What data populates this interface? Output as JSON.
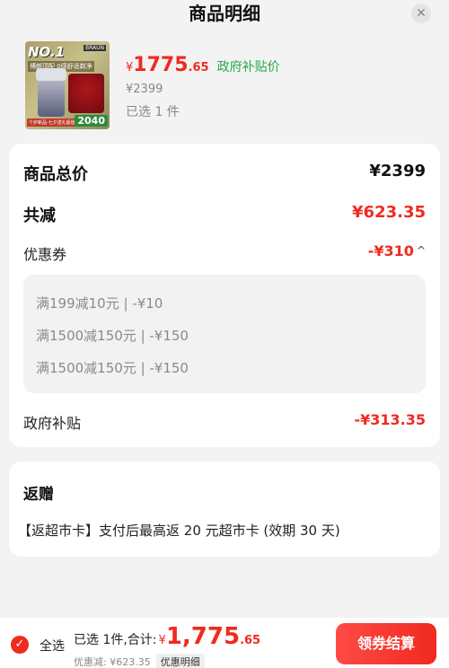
{
  "header": {
    "title": "商品明细",
    "close_icon": "close-icon"
  },
  "product": {
    "image_text": {
      "no1": "NO.1",
      "brand": "BRAUN",
      "slogan": "博朗顶配 0感舒适剃净",
      "badge_top": "个护新品·七夕送礼超值",
      "badge": "2040"
    },
    "price_symbol": "¥",
    "price_int": "1775",
    "price_dec": ".65",
    "price_tag": "政府补贴价",
    "original_price": "¥2399",
    "selected_count": "已选 1 件"
  },
  "summary": {
    "total_label": "商品总价",
    "total_value": "¥2399",
    "reduce_label": "共减",
    "reduce_value": "¥623.35",
    "coupon_label": "优惠券",
    "coupon_value": "-¥310",
    "coupon_chevron": "^",
    "coupons": [
      "满199减10元 | -¥10",
      "满1500减150元 | -¥150",
      "满1500减150元 | -¥150"
    ],
    "subsidy_label": "政府补贴",
    "subsidy_value": "-¥313.35"
  },
  "gift": {
    "title": "返赠",
    "description": "【返超市卡】支付后最高返 20 元超市卡 (效期 30 天)"
  },
  "bottom": {
    "select_all": "全选",
    "selected_total": "已选 1件,合计:",
    "price_symbol": "¥",
    "price_int": "1,775",
    "price_dec": ".65",
    "discount_text": "优惠减: ¥623.35",
    "detail_button": "优惠明细",
    "checkout_button": "领券结算"
  },
  "colors": {
    "accent": "#f02a1f",
    "gov_green": "#27a84a"
  }
}
